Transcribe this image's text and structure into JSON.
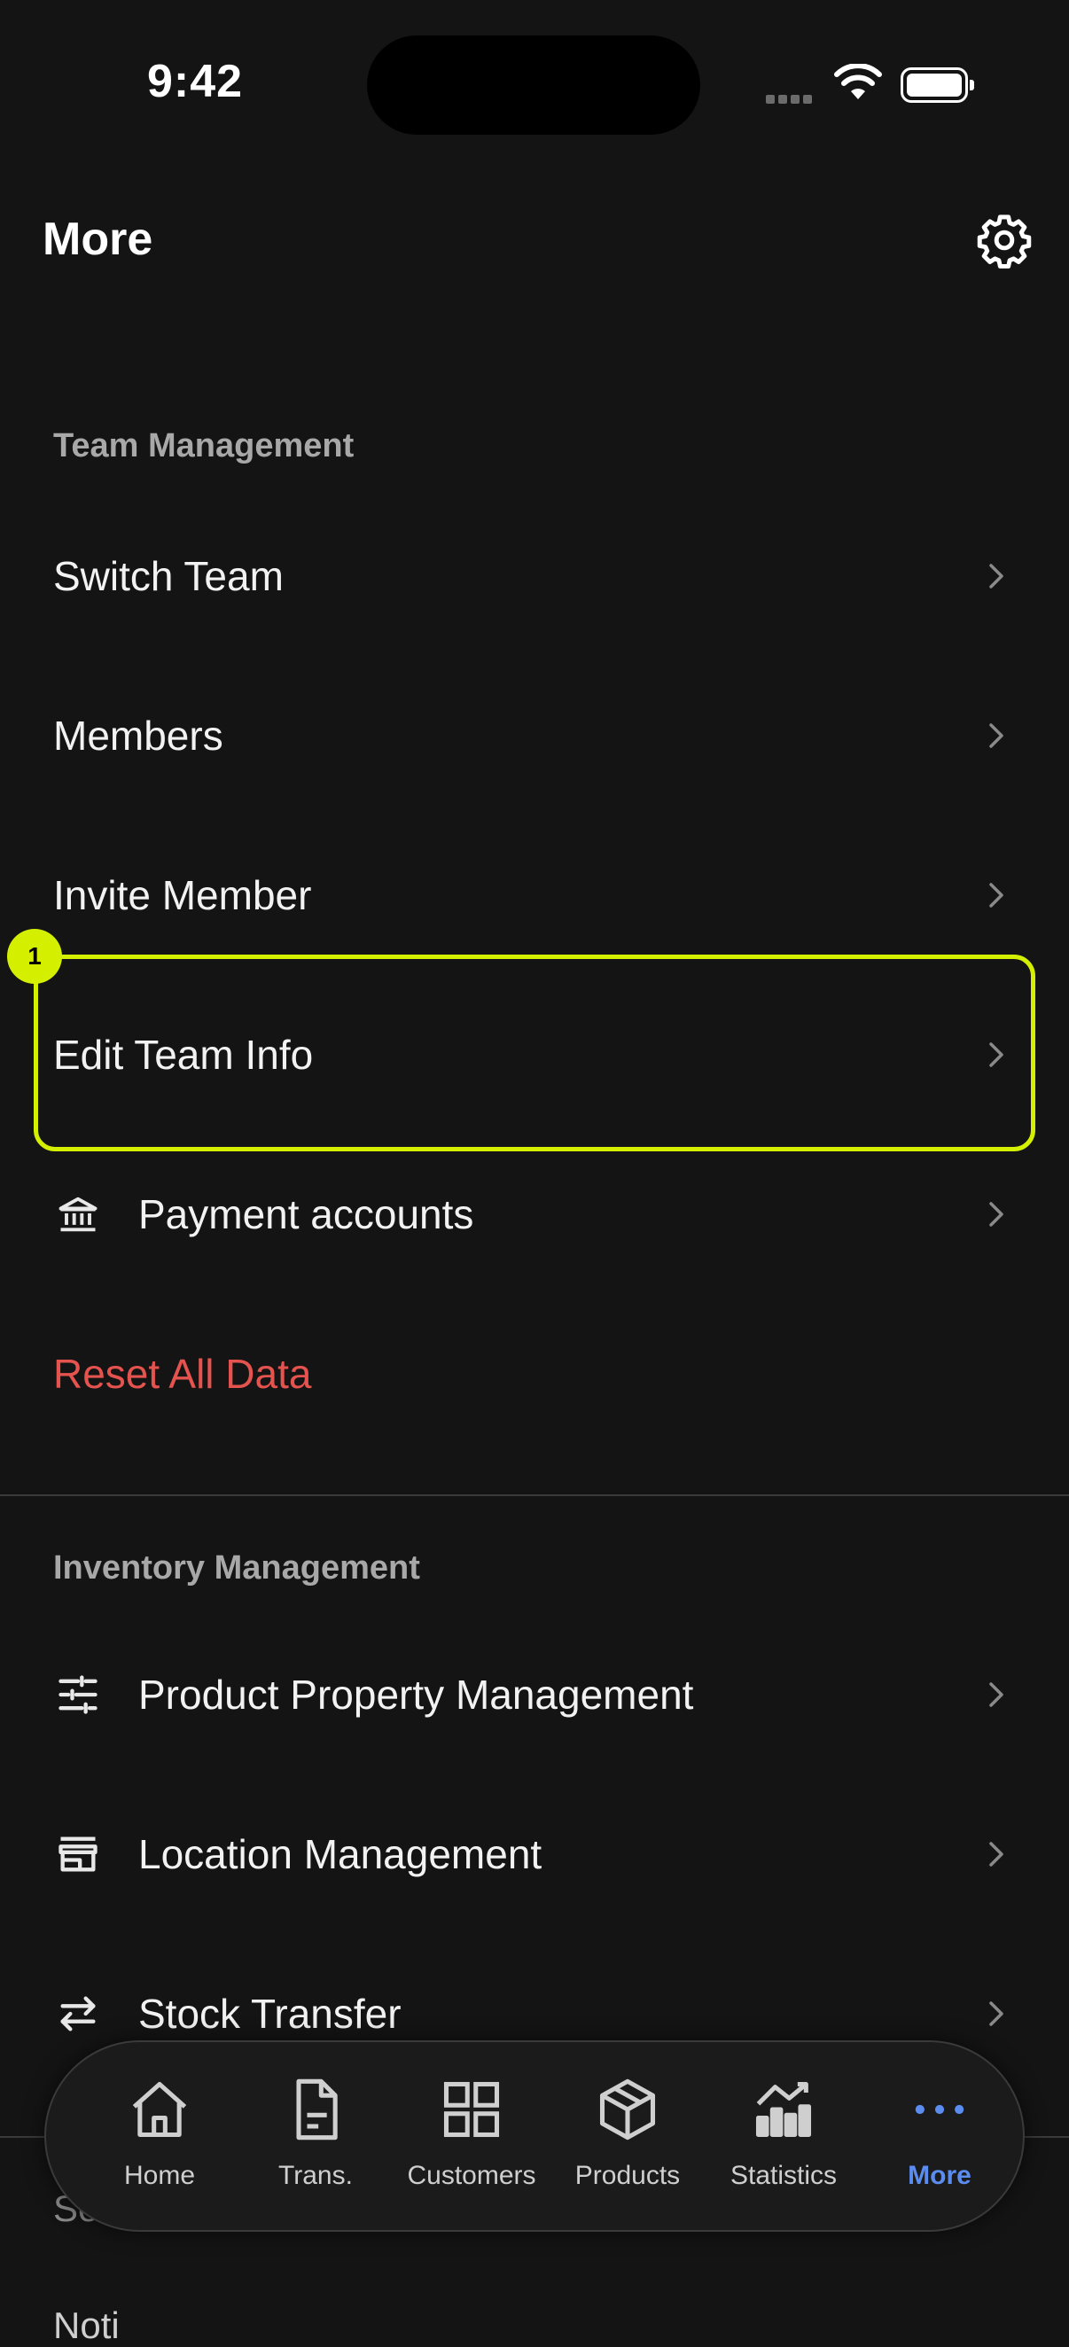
{
  "status_bar": {
    "time": "9:42"
  },
  "header": {
    "title": "More"
  },
  "team_section": {
    "title": "Team Management",
    "items": [
      {
        "label": "Switch Team"
      },
      {
        "label": "Members"
      },
      {
        "label": "Invite Member"
      },
      {
        "label": "Edit Team Info"
      },
      {
        "label": "Payment accounts",
        "icon": "bank-icon"
      },
      {
        "label": "Reset All Data",
        "color": "#e5534f"
      }
    ]
  },
  "inventory_section": {
    "title": "Inventory Management",
    "items": [
      {
        "label": "Product Property Management",
        "icon": "sliders-icon"
      },
      {
        "label": "Location Management",
        "icon": "store-icon"
      },
      {
        "label": "Stock Transfer",
        "icon": "transfer-arrows-icon"
      }
    ]
  },
  "partial_below": {
    "section_title": "Se",
    "item": "Noti"
  },
  "highlight_badge": "1",
  "bottom_nav": {
    "items": [
      {
        "label": "Home",
        "icon": "home-icon"
      },
      {
        "label": "Trans.",
        "icon": "document-icon"
      },
      {
        "label": "Customers",
        "icon": "grid-icon"
      },
      {
        "label": "Products",
        "icon": "box-icon"
      },
      {
        "label": "Statistics",
        "icon": "bar-chart-icon"
      },
      {
        "label": "More",
        "icon": "more-dots-icon",
        "active": true
      }
    ],
    "active_color": "#5b8cf0"
  },
  "colors": {
    "background": "#141414",
    "accent_highlight": "#d4f000",
    "danger": "#e5534f"
  }
}
